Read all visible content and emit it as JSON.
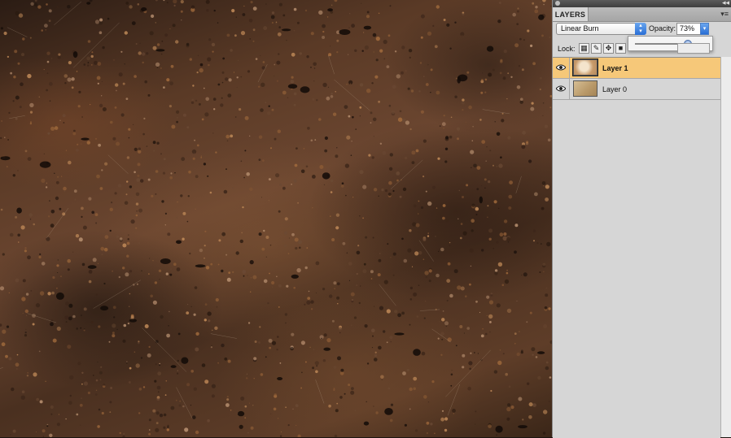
{
  "panel": {
    "tab_label": "LAYERS",
    "collapse_glyph": "◂◂",
    "menu_glyph": "▾≡"
  },
  "blend_mode": {
    "value": "Linear Burn",
    "arrows": "▴▾"
  },
  "opacity": {
    "label": "Opacity:",
    "value": "73%",
    "slider_fraction": 0.73
  },
  "lock": {
    "label": "Lock:",
    "buttons": [
      "lock-transparent-icon",
      "lock-image-icon",
      "lock-position-icon",
      "lock-all-icon"
    ]
  },
  "layers": [
    {
      "name": "Layer 1",
      "visible": true,
      "selected": true
    },
    {
      "name": "Layer 0",
      "visible": true,
      "selected": false
    }
  ],
  "colors": {
    "selected_row": "#f6c879",
    "panel_bg": "#d6d6d6",
    "accent_blue": "#2a6fd6"
  }
}
